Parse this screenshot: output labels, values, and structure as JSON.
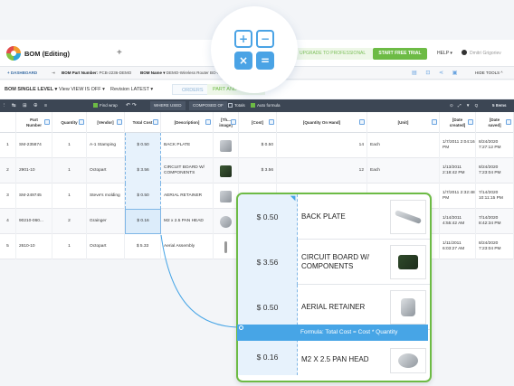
{
  "app": {
    "title": "BOM (Editing)",
    "add_label": "+",
    "upgrade_label": "UPGRADE TO PROFESSIONAL",
    "free_trial_label": "START FREE TRIAL",
    "help_label": "HELP ▾",
    "user_label": "Dmitri Grigoriev"
  },
  "breadcrumb": {
    "dashboard": "+ DASHBOARD",
    "arrow": "⇥",
    "part_number_label": "BOM Part Number:",
    "part_number_value": "PCB-2236-DEMO",
    "bom_name_label": "BOM Name ▾",
    "bom_name_value": "DEMO-Wireless Router BO-P...",
    "icons": "▤ ⊡ ⋖ ▣",
    "hide_tools": "HIDE TOOLS ^"
  },
  "bom_toolbar": {
    "level": "BOM SINGLE LEVEL ▾",
    "view": "View VIEW IS OFF ▾",
    "revision": "Revision LATEST ▾",
    "tab_orders": "ORDERS",
    "tab_parts": "PART AND CATEG..."
  },
  "grid_toolbar": {
    "icons": "⫶ ↹ ⊞ ⊕ ≡",
    "find_wrap": "Find wrap",
    "undo_redo": "↶ ↷",
    "where_used": "WHERE USED",
    "composed_of": "COMPOSED OF",
    "totals": "Totals",
    "auto_formula": "Auto formula",
    "right_icons": "⊙ ⤢ ▼ Q",
    "rows": "5 Items"
  },
  "columns": [
    "",
    "Part Number",
    "Quantity",
    "[Vendor]",
    "Total Cost",
    "[Description]",
    "[Th... image]",
    "[Cost]",
    "[Quantity On Hand]",
    "[Unit]",
    "[Date created]",
    "[Date saved]"
  ],
  "rows": [
    {
      "idx": "1",
      "part": "SM-235874",
      "qty": "1",
      "vendor": "A-1 Stamping",
      "total": "$ 0.50",
      "desc": "BACK PLATE",
      "cost": "$ 0.50",
      "onhand": "14",
      "unit": "Each",
      "created": "1/7/2011 2:04:16 PM",
      "saved": "8/24/2020 7:27:12 PM"
    },
    {
      "idx": "2",
      "part": "2901-10",
      "qty": "1",
      "vendor": "Octopart",
      "total": "$ 3.56",
      "desc": "CIRCUIT BOARD W/ COMPONENTS",
      "cost": "$ 3.56",
      "onhand": "12",
      "unit": "Each",
      "created": "1/13/2011 2:18:42 PM",
      "saved": "8/24/2020 7:23:04 PM"
    },
    {
      "idx": "3",
      "part": "SM-249745",
      "qty": "1",
      "vendor": "Steve's molding",
      "total": "$ 0.50",
      "desc": "AERIAL RETAINER",
      "cost": "",
      "onhand": "",
      "unit": "",
      "created": "1/7/2011 2:32:48 PM",
      "saved": "7/14/2020 10:11:15 PM"
    },
    {
      "idx": "4",
      "part": "90210-060...",
      "qty": "2",
      "vendor": "Grainger",
      "total": "$ 0.16",
      "desc": "M2 x 2.5 PAN HEAD",
      "cost": "",
      "onhand": "",
      "unit": "",
      "created": "1/14/2011 4:55:42 AM",
      "saved": "7/14/2020 8:42:34 PM"
    },
    {
      "idx": "5",
      "part": "2610-10",
      "qty": "1",
      "vendor": "Octopart",
      "total": "$ 5.33",
      "desc": "Aerial Assembly",
      "cost": "",
      "onhand": "",
      "unit": "",
      "created": "1/11/2011 6:03:27 AM",
      "saved": "8/24/2020 7:23:04 PM"
    }
  ],
  "popup": {
    "rows": [
      {
        "cost": "$ 0.50",
        "desc": "BACK PLATE"
      },
      {
        "cost": "$ 3.56",
        "desc": "CIRCUIT BOARD W/ COMPONENTS"
      },
      {
        "cost": "$ 0.50",
        "desc": "AERIAL RETAINER"
      },
      {
        "cost": "$ 0.16",
        "desc": "M2 X 2.5 PAN HEAD"
      }
    ],
    "formula": "Formula: Total Cost = Cost * Quantity"
  },
  "calc_keys": [
    "+",
    "−",
    "×",
    "="
  ],
  "colors": {
    "accent_green": "#6dbb45",
    "accent_blue": "#47a5e6",
    "toolbar_dark": "#3c4654"
  }
}
